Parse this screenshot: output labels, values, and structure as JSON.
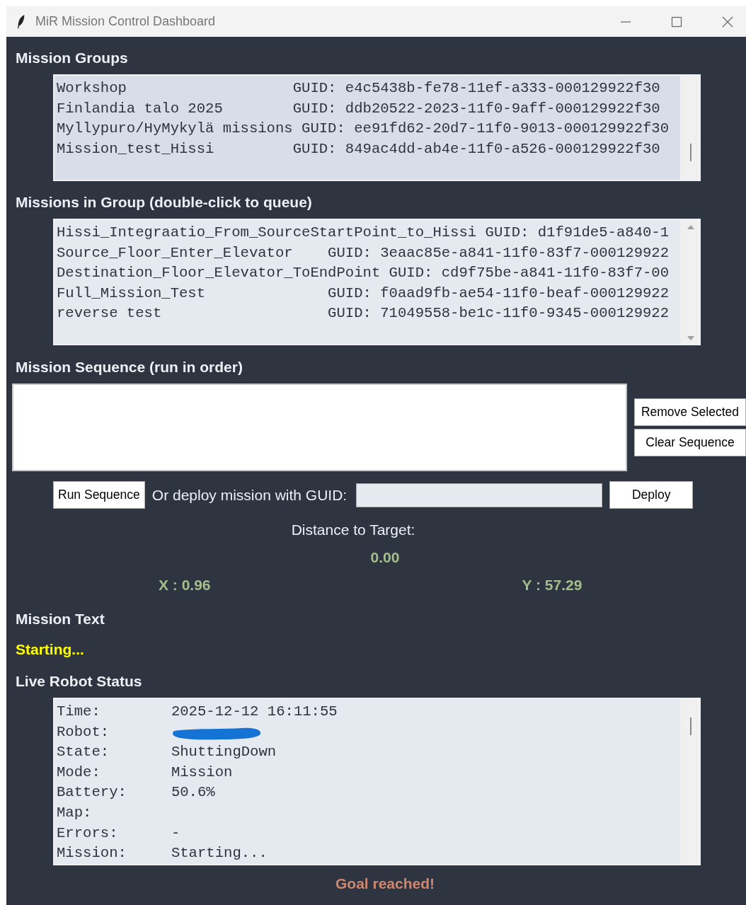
{
  "window": {
    "title": "MiR Mission Control Dashboard"
  },
  "mission_groups": {
    "heading": "Mission Groups",
    "rows": [
      {
        "text": "Workshop                   GUID: e4c5438b-fe78-11ef-a333-000129922f30"
      },
      {
        "text": "Finlandia talo 2025        GUID: ddb20522-2023-11f0-9aff-000129922f30"
      },
      {
        "text": "Myllypuro/HyMykylä missions GUID: ee91fd62-20d7-11f0-9013-000129922f30"
      },
      {
        "text": "Mission_test_Hissi         GUID: 849ac4dd-ab4e-11f0-a526-000129922f30"
      }
    ]
  },
  "missions_in_group": {
    "heading": "Missions in Group (double-click to queue)",
    "rows": [
      {
        "text": "Hissi_Integraatio_From_SourceStartPoint_to_Hissi GUID: d1f91de5-a840-1"
      },
      {
        "text": "Source_Floor_Enter_Elevator    GUID: 3eaac85e-a841-11f0-83f7-000129922"
      },
      {
        "text": "Destination_Floor_Elevator_ToEndPoint GUID: cd9f75be-a841-11f0-83f7-00"
      },
      {
        "text": "Full_Mission_Test              GUID: f0aad9fb-ae54-11f0-beaf-000129922"
      },
      {
        "text": "reverse test                   GUID: 71049558-be1c-11f0-9345-000129922"
      }
    ]
  },
  "mission_sequence": {
    "heading": "Mission Sequence (run in order)",
    "buttons": [
      "Remove Selected",
      "Clear Sequence"
    ]
  },
  "deploy_bar": {
    "run_button": "Run Sequence",
    "label": "Or deploy mission with GUID:",
    "deploy_button": "Deploy"
  },
  "distance": {
    "label": "Distance to Target:",
    "value": "0.00",
    "x": "X : 0.96",
    "y": "Y : 57.29"
  },
  "mission_text": {
    "heading": "Mission Text",
    "value": "Starting..."
  },
  "live_status": {
    "heading": "Live Robot Status",
    "rows": [
      {
        "label": "Time:",
        "value": "2025-12-12 16:11:55",
        "redacted": false
      },
      {
        "label": "Robot:",
        "redacted": true
      },
      {
        "label": "State:",
        "value": "ShuttingDown",
        "redacted": false
      },
      {
        "label": "Mode:",
        "value": "Mission",
        "redacted": false
      },
      {
        "label": "Battery:",
        "value": "50.6%",
        "redacted": false
      },
      {
        "label": "Map:",
        "redacted": false
      },
      {
        "label": "Errors:",
        "value": "-",
        "redacted": false
      },
      {
        "label": "Mission:",
        "value": "Starting...",
        "redacted": false
      }
    ]
  },
  "goal_message": "Goal reached!"
}
